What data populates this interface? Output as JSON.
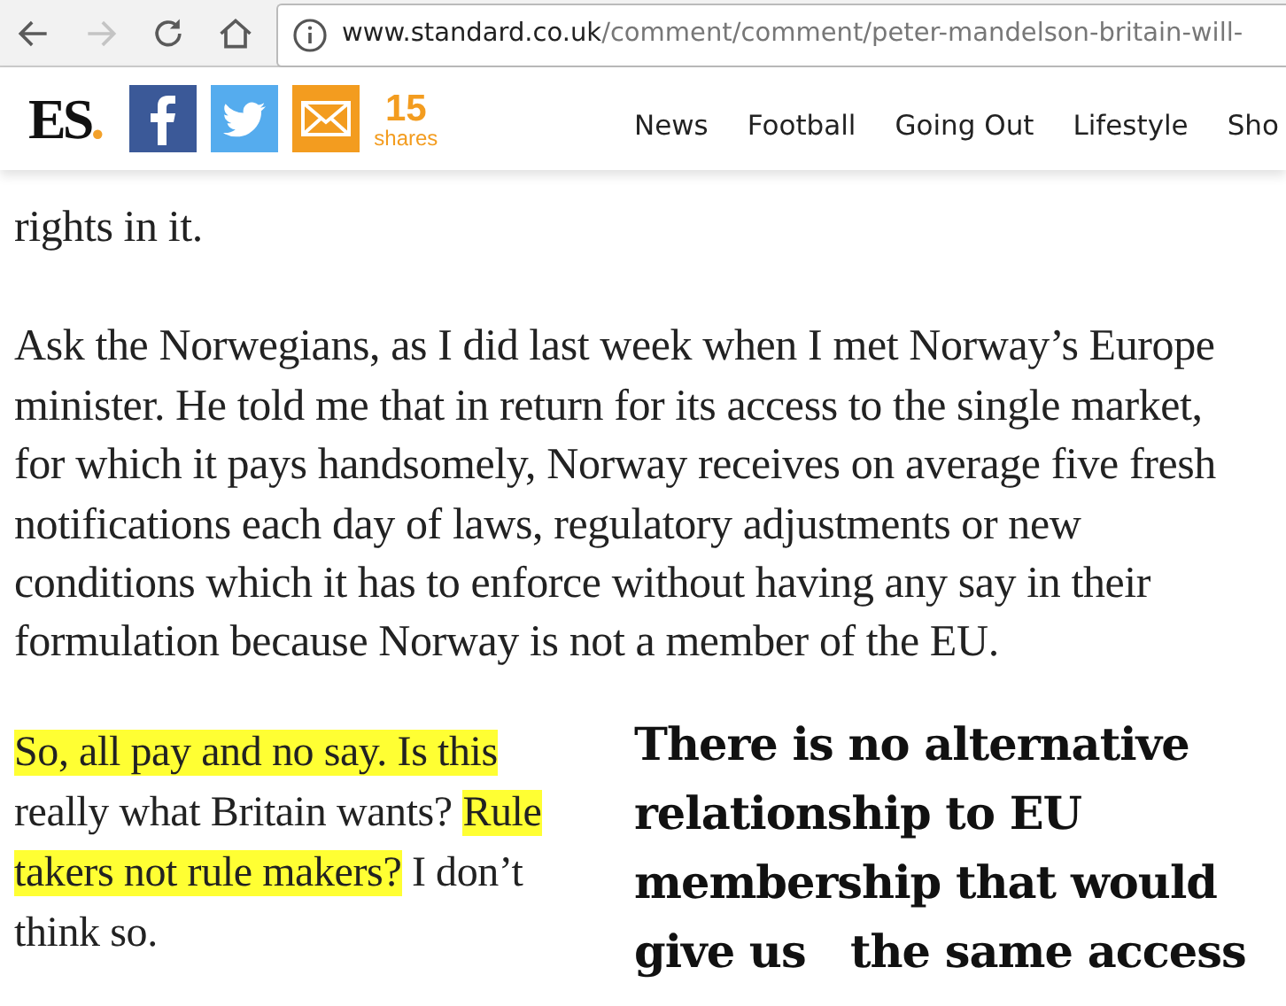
{
  "browser": {
    "back_enabled": true,
    "forward_enabled": false,
    "url_host": "www.standard.co.uk",
    "url_path": "/comment/comment/peter-mandelson-britain-will-"
  },
  "header": {
    "logo_letters": "ES",
    "logo_dot": ".",
    "share_count": "15",
    "share_label": "shares",
    "nav": [
      {
        "label": "News"
      },
      {
        "label": "Football"
      },
      {
        "label": "Going Out"
      },
      {
        "label": "Lifestyle"
      },
      {
        "label": "Sho"
      }
    ]
  },
  "article": {
    "paragraphs": [
      {
        "lines": [
          "rights in it."
        ]
      },
      {
        "lines": [
          "Ask the Norwegians, as I did last week when I met Norway’s Europe",
          "minister. He told me that in return for its access to the single market,",
          "for which it pays handsomely, Norway receives on average five fresh",
          "notifications each day of laws, regulatory adjustments or new",
          "conditions which it has to enforce without having any say in their",
          "formulation because Norway is not a member of the   EU."
        ]
      }
    ],
    "highlighted_paragraph": {
      "lines": [
        [
          {
            "text": "So, all pay and no say. Is this",
            "highlighted": true
          }
        ],
        [
          {
            "text": "really what Britain wants? ",
            "highlighted": false
          },
          {
            "text": "Rule",
            "highlighted": true
          }
        ],
        [
          {
            "text": "takers not rule makers?",
            "highlighted": true
          },
          {
            "text": " I don’t",
            "highlighted": false
          }
        ],
        [
          {
            "text": "think so.",
            "highlighted": false
          }
        ]
      ]
    },
    "pull_quote": {
      "lines": [
        "There is no alternative",
        "relationship to EU",
        "membership that would",
        "give us   the same access"
      ]
    }
  }
}
